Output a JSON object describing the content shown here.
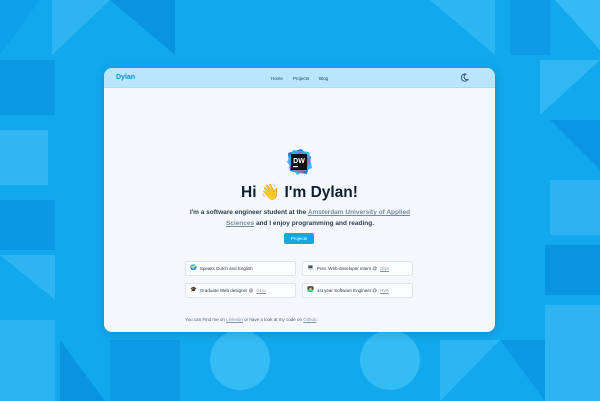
{
  "navbar": {
    "brand": "Dylan",
    "links": [
      "Home",
      "Projects",
      "Blog"
    ]
  },
  "logo": {
    "text": "DW"
  },
  "hero": {
    "title_prefix": "Hi",
    "wave_emoji": "👋",
    "title_suffix": "I'm Dylan!",
    "desc_part1": "I'm a software engineer student at the",
    "desc_link": "Amsterdam University of Applied Sciences",
    "desc_part2": "and I enjoy programming and reading.",
    "button_label": "Projects"
  },
  "cards": [
    {
      "icon": "🌍",
      "text": "Speaks Dutch and English",
      "muted": ""
    },
    {
      "icon": "💻",
      "text": "Prev. Web-developer intern @",
      "muted": "Qlys"
    },
    {
      "icon": "🎓",
      "text": "Graduate Web designer @",
      "muted": "GLU"
    },
    {
      "icon": "🧑‍💻",
      "text": "1st year Software Engineer @",
      "muted": "HVA"
    }
  ],
  "footer": {
    "part1": "You can Find me on",
    "link1": "Linkedin",
    "part2": "or have a look at my code on",
    "link2": "Github",
    "part3": "."
  },
  "colors": {
    "background": "#12a8ee",
    "navbar": "#b9e6fb",
    "accent": "#17a6df",
    "text_dark": "#0f1f33"
  }
}
